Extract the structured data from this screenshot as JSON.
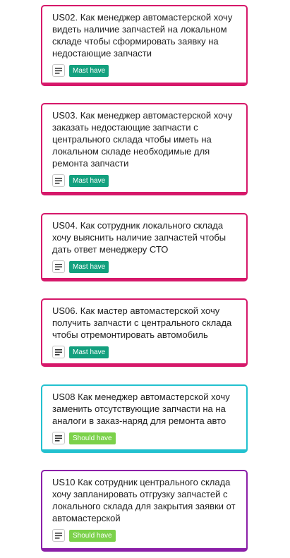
{
  "colors": {
    "must_border": "#d6186a",
    "should_border_1": "#22c1cf",
    "should_border_2": "#8b1fa8",
    "must_badge": "#13a07e",
    "should_badge": "#7bd14a",
    "desc_icon": "#333333"
  },
  "cards": [
    {
      "title": "US02. Как менеджер автомастерской хочу видеть наличие запчастей на локальном складе чтобы сформировать заявку на недостающие запчасти",
      "tag": "Mast have",
      "description_icon": "description-icon"
    },
    {
      "title": "US03. Как менеджер автомастерской хочу заказать недостающие запчасти с центрального склада чтобы иметь на локальном складе необходимые для ремонта запчасти",
      "tag": "Mast have",
      "description_icon": "description-icon"
    },
    {
      "title": "US04. Как сотрудник локального склада хочу выяснить наличие запчастей чтобы дать ответ менеджеру СТО",
      "tag": "Mast have",
      "description_icon": "description-icon"
    },
    {
      "title": "US06. Как мастер автомастерской хочу получить запчасти с центрального склада чтобы отремонтировать автомобиль",
      "tag": "Mast have",
      "description_icon": "description-icon"
    },
    {
      "title": "US08 Как менеджер автомастерской хочу заменить отсутствующие запчасти на на аналоги в заказ-наряд для ремонта авто",
      "tag": "Should have",
      "description_icon": "description-icon"
    },
    {
      "title": "US10 Как сотрудник центрального склада хочу запланировать отгрузку запчастей с локального склада для закрытия заявки от автомастерской",
      "tag": "Should have",
      "description_icon": "description-icon"
    }
  ]
}
